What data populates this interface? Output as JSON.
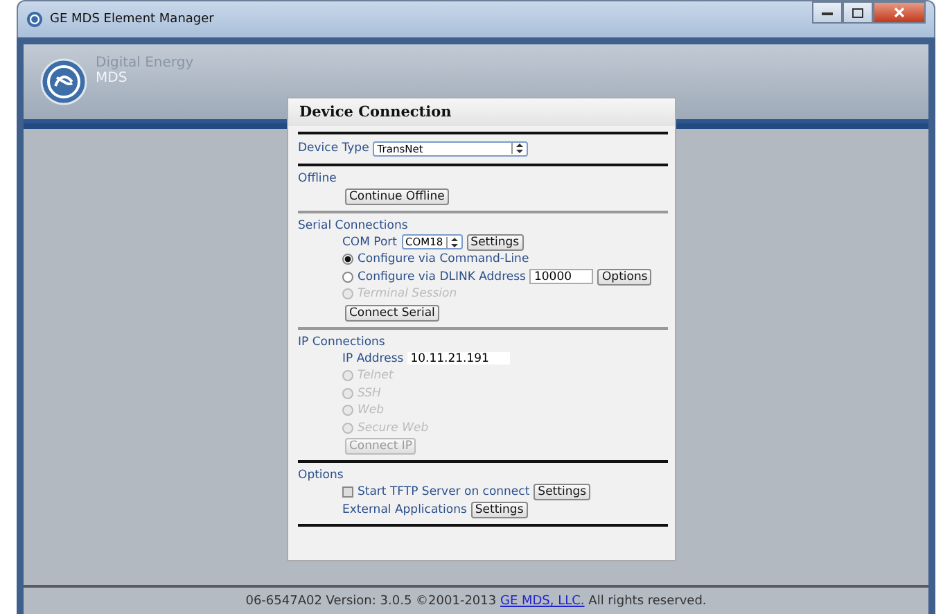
{
  "window": {
    "title": "GE MDS Element Manager"
  },
  "header": {
    "brand": "Digital Energy",
    "product": "MDS"
  },
  "dialog": {
    "title": "Device Connection",
    "device_type": {
      "label": "Device Type",
      "value": "TransNet"
    },
    "offline": {
      "heading": "Offline",
      "button": "Continue Offline"
    },
    "serial": {
      "heading": "Serial Connections",
      "com_label": "COM Port",
      "com_value": "COM18",
      "settings_button": "Settings",
      "modes": [
        {
          "label": "Configure via Command-Line",
          "selected": true,
          "disabled": false
        },
        {
          "label": "Configure via DLINK Address",
          "selected": false,
          "disabled": false,
          "address": "10000",
          "button": "Options"
        },
        {
          "label": "Terminal Session",
          "selected": false,
          "disabled": true
        }
      ],
      "connect_button": "Connect Serial"
    },
    "ip": {
      "heading": "IP Connections",
      "address_label": "IP Address",
      "address_value": "10.11.21.191",
      "modes": [
        {
          "label": "Telnet",
          "selected": false,
          "disabled": true
        },
        {
          "label": "SSH",
          "selected": false,
          "disabled": true
        },
        {
          "label": "Web",
          "selected": false,
          "disabled": true
        },
        {
          "label": "Secure Web",
          "selected": false,
          "disabled": true
        }
      ],
      "connect_button": "Connect IP",
      "connect_disabled": true
    },
    "options": {
      "heading": "Options",
      "tftp": {
        "label": "Start TFTP Server on connect",
        "checked": false,
        "button": "Settings"
      },
      "external": {
        "label": "External Applications",
        "button": "Settings"
      }
    }
  },
  "footer": {
    "before": "06-6547A02 Version: 3.0.5 ©2001-2013",
    "link": "GE MDS, LLC.",
    "after": "All rights reserved."
  }
}
